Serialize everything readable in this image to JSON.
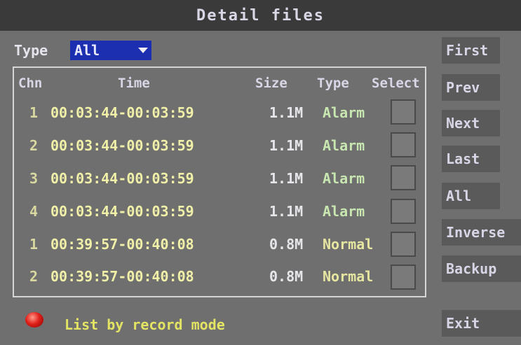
{
  "window": {
    "title": "Detail files"
  },
  "filter": {
    "label": "Type",
    "selected": "All"
  },
  "table": {
    "headers": {
      "chn": "Chn",
      "time": "Time",
      "size": "Size",
      "type": "Type",
      "select": "Select"
    },
    "rows": [
      {
        "chn": "1",
        "time": "00:03:44-00:03:59",
        "size": "1.1M",
        "type": "Alarm",
        "selected": false
      },
      {
        "chn": "2",
        "time": "00:03:44-00:03:59",
        "size": "1.1M",
        "type": "Alarm",
        "selected": false
      },
      {
        "chn": "3",
        "time": "00:03:44-00:03:59",
        "size": "1.1M",
        "type": "Alarm",
        "selected": false
      },
      {
        "chn": "4",
        "time": "00:03:44-00:03:59",
        "size": "1.1M",
        "type": "Alarm",
        "selected": false
      },
      {
        "chn": "1",
        "time": "00:39:57-00:40:08",
        "size": "0.8M",
        "type": "Normal",
        "selected": false
      },
      {
        "chn": "2",
        "time": "00:39:57-00:40:08",
        "size": "0.8M",
        "type": "Normal",
        "selected": false
      }
    ]
  },
  "buttons": {
    "first": "First",
    "prev": "Prev",
    "next": "Next",
    "last": "Last",
    "all": "All",
    "inverse": "Inverse",
    "backup": "Backup",
    "exit": "Exit"
  },
  "footer": {
    "mode_label": "List by record mode",
    "indicator_color": "#e0201a"
  },
  "colors": {
    "title_bar": "#3a3a3a",
    "background": "#6f6f6f",
    "select_highlight": "#1c2fb0"
  }
}
